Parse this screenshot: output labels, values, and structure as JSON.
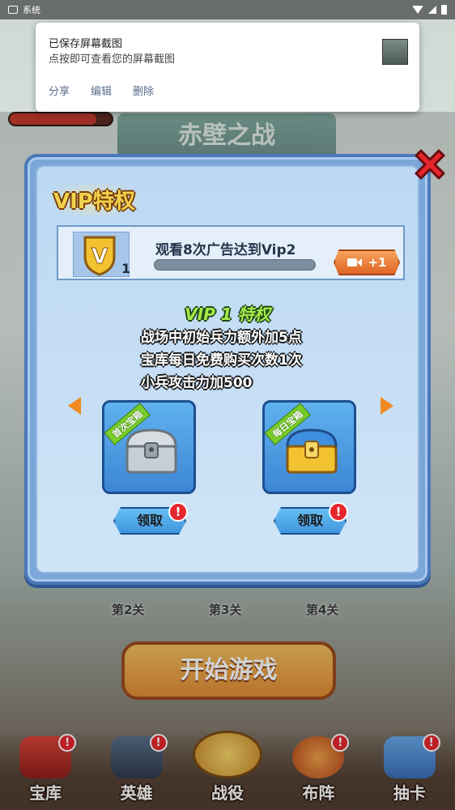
{
  "status_bar": {
    "app_label": "系统"
  },
  "notification": {
    "title": "已保存屏幕截图",
    "text": "点按即可查看您的屏幕截图",
    "actions": [
      "分享",
      "编辑",
      "删除"
    ]
  },
  "background": {
    "stage_title": "赤壁之战",
    "levels": [
      "第2关",
      "第3关",
      "第4关"
    ],
    "start_button": "开始游戏"
  },
  "vip_dialog": {
    "title": "VIP特权",
    "current_level": "1",
    "progress_text": "观看8次广告达到Vip2",
    "progress_fraction": 0.0,
    "ad_button_label": "+1",
    "privilege_title": "VIP 1 特权",
    "privileges": [
      "战场中初始兵力额外加5点",
      "宝库每日免费购买次数1次",
      "小兵攻击力加500"
    ],
    "rewards": [
      {
        "tag": "首次宝箱",
        "claim_label": "领取",
        "badge": "!"
      },
      {
        "tag": "每日宝箱",
        "claim_label": "领取",
        "badge": "!"
      }
    ]
  },
  "bottom_nav": {
    "items": [
      {
        "label": "宝库",
        "badge": "!"
      },
      {
        "label": "英雄",
        "badge": "!"
      },
      {
        "label": "战役",
        "badge": ""
      },
      {
        "label": "布阵",
        "badge": "!"
      },
      {
        "label": "抽卡",
        "badge": "!"
      }
    ]
  },
  "colors": {
    "accent_orange": "#f08a22",
    "dialog_blue": "#7aa6d8",
    "badge_red": "#e5262d"
  }
}
